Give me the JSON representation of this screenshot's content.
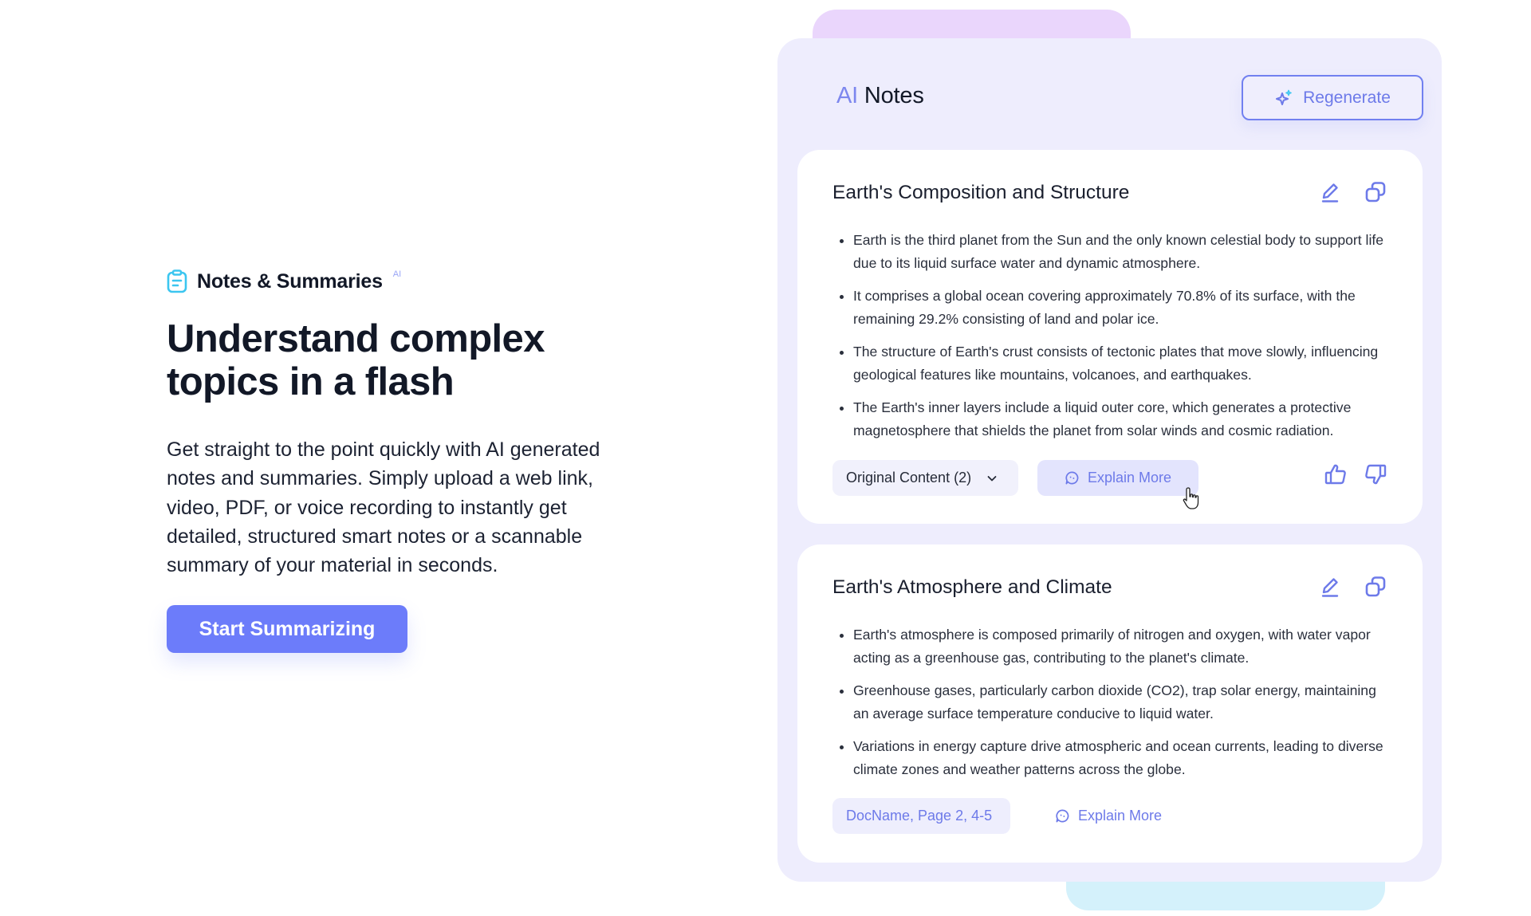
{
  "hero": {
    "feature_tag": {
      "icon": "clipboard-icon",
      "label": "Notes & Summaries",
      "badge": "AI"
    },
    "headline": "Understand complex topics in a flash",
    "description": "Get straight to the point quickly with AI generated notes and summaries. Simply upload a web link, video, PDF, or voice recording to instantly get detailed, structured smart notes or a scannable summary of your material in seconds.",
    "cta_label": "Start Summarizing"
  },
  "panel": {
    "title_prefix": "AI",
    "title": "Notes",
    "regenerate_label": "Regenerate",
    "regenerate_icon": "sparkles-icon",
    "cards": [
      {
        "title": "Earth's Composition and Structure",
        "actions": [
          "edit-icon",
          "copy-icon"
        ],
        "bullets": [
          "Earth is the third planet from the Sun and the only known celestial body to support life due to its liquid surface water and dynamic atmosphere.",
          "It comprises a global ocean covering approximately 70.8% of its surface, with the remaining 29.2% consisting of land and polar ice.",
          "The structure of Earth's crust consists of tectonic plates that move slowly, influencing geological features like mountains, volcanoes, and earthquakes.",
          "The Earth's inner layers include a liquid outer core, which generates a protective magnetosphere that shields the planet from solar winds and cosmic radiation."
        ],
        "source_label": "Original Content (2)",
        "explain_label": "Explain More",
        "feedback": [
          "thumbs-up-icon",
          "thumbs-down-icon"
        ]
      },
      {
        "title": "Earth's Atmosphere and Climate",
        "actions": [
          "edit-icon",
          "copy-icon"
        ],
        "bullets": [
          "Earth's atmosphere is composed primarily of nitrogen and oxygen, with water vapor acting as a greenhouse gas, contributing to the planet's climate.",
          "Greenhouse gases, particularly carbon dioxide (CO2), trap solar energy, maintaining an average surface temperature conducive to liquid water.",
          "Variations in energy capture drive atmospheric and ocean currents, leading to diverse climate zones and weather patterns across the globe."
        ],
        "source_label": "DocName, Page 2, 4-5",
        "explain_label": "Explain More"
      }
    ]
  },
  "colors": {
    "accent": "#6c7cfa",
    "panel_bg": "#eeedfd",
    "deco_purple": "#ead6fc",
    "deco_cyan": "#d4f1fb",
    "tag_icon": "#3cc6f0"
  }
}
